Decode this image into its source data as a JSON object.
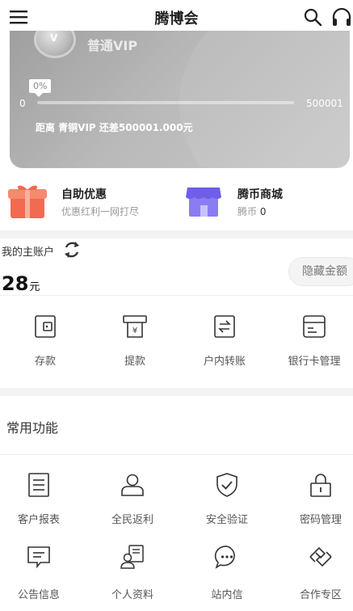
{
  "header": {
    "title": "腾博会",
    "menu_icon": "menu-icon",
    "search_icon": "search-icon",
    "support_icon": "headset-icon"
  },
  "vip": {
    "level_name": "普通VIP",
    "medal_letter": "V",
    "progress_percent": "0%",
    "progress_fraction": 0,
    "range_start": "0",
    "range_end": "500001",
    "gap_text": "距离 青铜VIP 还差500001.000元",
    "card_color": "#b4b4b4"
  },
  "promos": [
    {
      "title": "自助优惠",
      "subtitle": "优惠红利一网打尽",
      "icon": "gift-icon",
      "color": "#f0624a"
    },
    {
      "title": "腾币商城",
      "subtitle_prefix": "腾币",
      "subtitle_value": "0",
      "icon": "store-icon",
      "color": "#7b6cf0"
    }
  ],
  "account": {
    "label": "我的主账户",
    "refresh_icon": "refresh-icon",
    "balance": "28",
    "unit": "元",
    "hide_button": "隐藏金额"
  },
  "quick_actions": [
    {
      "label": "存款",
      "icon": "wallet-icon"
    },
    {
      "label": "提款",
      "icon": "withdraw-icon"
    },
    {
      "label": "户内转账",
      "icon": "transfer-icon"
    },
    {
      "label": "银行卡管理",
      "icon": "bank-card-icon"
    }
  ],
  "common": {
    "title": "常用功能",
    "items": [
      {
        "label": "客户报表",
        "icon": "report-icon"
      },
      {
        "label": "全民返利",
        "icon": "user-rebate-icon"
      },
      {
        "label": "安全验证",
        "icon": "shield-check-icon"
      },
      {
        "label": "密码管理",
        "icon": "lock-icon"
      },
      {
        "label": "公告信息",
        "icon": "announcement-icon"
      },
      {
        "label": "个人资料",
        "icon": "profile-card-icon"
      },
      {
        "label": "站内信",
        "icon": "message-icon"
      },
      {
        "label": "合作专区",
        "icon": "handshake-icon"
      }
    ]
  }
}
